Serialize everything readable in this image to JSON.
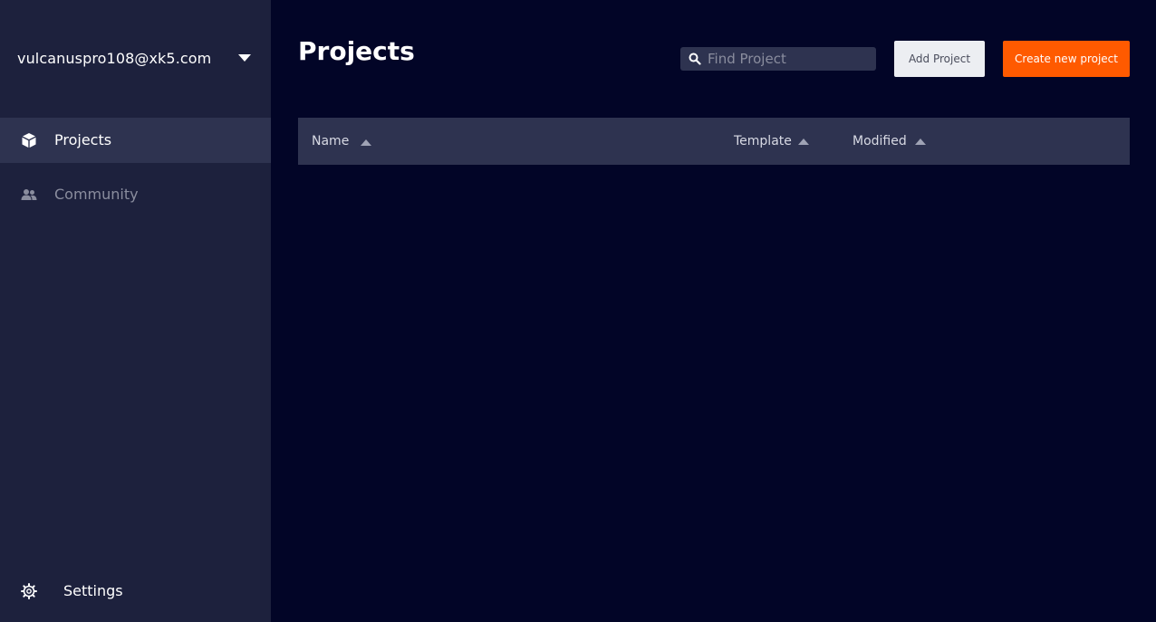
{
  "sidebar": {
    "account_email": "vulcanuspro108@xk5.com",
    "nav": {
      "projects_label": "Projects",
      "community_label": "Community"
    },
    "settings_label": "Settings"
  },
  "main": {
    "title": "Projects",
    "search": {
      "placeholder": "Find Project",
      "value": ""
    },
    "add_project_label": "Add Project",
    "create_project_label": "Create new project",
    "table": {
      "columns": [
        "Name",
        "Template",
        "Modified"
      ],
      "rows": []
    }
  },
  "colors": {
    "background": "#020527",
    "sidebar": "#1d213d",
    "active_item": "#2e3350",
    "accent": "#ff5a00"
  },
  "icons": {
    "account_menu": "caret-down-icon",
    "projects": "cube-icon",
    "community": "users-icon",
    "settings": "gear-icon",
    "search": "search-icon"
  }
}
